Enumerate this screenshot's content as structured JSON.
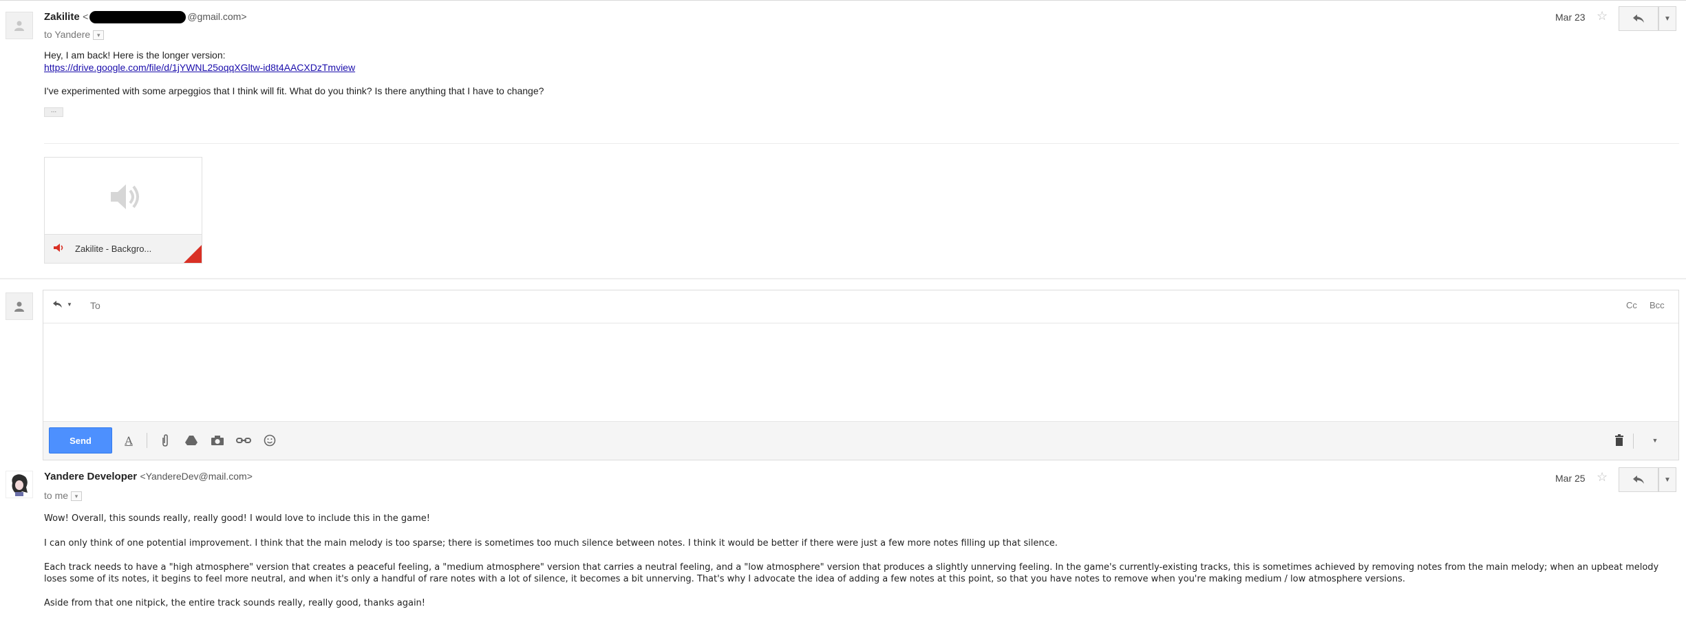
{
  "message1": {
    "sender_name": "Zakilite",
    "sender_email_suffix": "@gmail.com>",
    "sender_email_prefix": "<",
    "recipient_line": "to Yandere",
    "date": "Mar 23",
    "body_line1": "Hey, I am back! Here is the longer version:",
    "link": "https://drive.google.com/file/d/1jYWNL25oqqXGltw-id8t4AACXDzTmview",
    "body_line2": "I've experimented with some arpeggios that I think will fit. What do you think? Is there anything that I have to change?",
    "trimmed": "...",
    "attachment_name": "Zakilite - Backgro..."
  },
  "compose": {
    "to_label": "To",
    "cc_label": "Cc",
    "bcc_label": "Bcc",
    "send_label": "Send"
  },
  "message2": {
    "sender_name": "Yandere Developer",
    "sender_email": "<YandereDev@mail.com>",
    "recipient_line": "to me",
    "date": "Mar 25",
    "paragraphs": [
      "Wow! Overall, this sounds really, really good! I would love to include this in the game!",
      "I can only think of one potential improvement. I think that the main melody is too sparse; there is sometimes too much silence between notes. I think it would be better if there were just a few more notes filling up that silence.",
      "Each track needs to have a \"high atmosphere\" version that creates a peaceful feeling, a \"medium atmosphere\" version that carries a neutral feeling, and a \"low atmosphere\" version that produces a slightly unnerving feeling. In the game's currently-existing tracks, this is sometimes achieved by removing notes from the main melody; when an upbeat melody loses some of its notes, it begins to feel more neutral, and when it's only a handful of rare notes with a lot of silence, it becomes a bit unnerving. That's why I advocate the idea of adding a few notes at this point, so that you have notes to remove when you're making medium / low atmosphere versions.",
      "Aside from that one nitpick, the entire track sounds really, really good, thanks again!"
    ]
  },
  "icons": {
    "star": "star-icon",
    "reply": "reply-icon",
    "more": "chevron-down-icon",
    "speaker": "speaker-icon",
    "person": "person-icon"
  }
}
